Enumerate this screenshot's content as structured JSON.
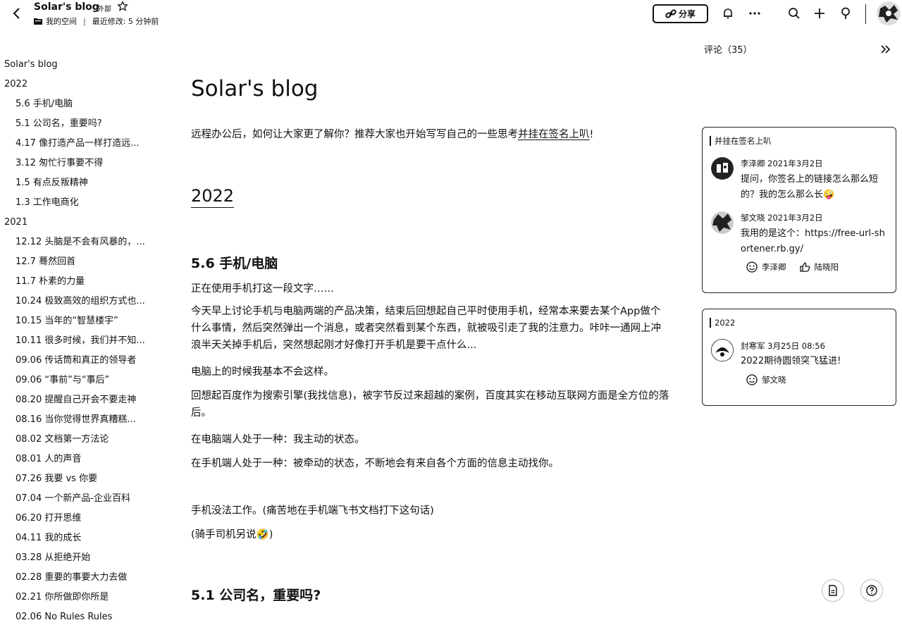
{
  "header": {
    "title": "Solar's blog",
    "external_badge": "外部",
    "location": "我的空间",
    "modified": "最近修改: 5 分钟前",
    "share_label": "分享"
  },
  "outline": {
    "items": [
      {
        "label": "Solar's blog",
        "level": 1
      },
      {
        "label": "2022",
        "level": 1
      },
      {
        "label": "5.6 手机/电脑",
        "level": 2
      },
      {
        "label": "5.1 公司名，重要吗?",
        "level": 2
      },
      {
        "label": "4.17 像打造产品一样打造远...",
        "level": 2
      },
      {
        "label": "3.12 匆忙行事要不得",
        "level": 2
      },
      {
        "label": "1.5 有点反叛精神",
        "level": 2
      },
      {
        "label": "1.3 工作电商化",
        "level": 2
      },
      {
        "label": "2021",
        "level": 1
      },
      {
        "label": "12.12 头脑是不会有风暴的，...",
        "level": 2
      },
      {
        "label": "12.7 蓦然回首",
        "level": 2
      },
      {
        "label": "11.7 朴素的力量",
        "level": 2
      },
      {
        "label": "10.24 极致高效的组织方式也...",
        "level": 2
      },
      {
        "label": "10.15 当年的“智慧楼宇”",
        "level": 2
      },
      {
        "label": "10.11 很多时候，我们并不知...",
        "level": 2
      },
      {
        "label": "09.06 传话筒和真正的领导者",
        "level": 2
      },
      {
        "label": "09.06 “事前”与“事后”",
        "level": 2
      },
      {
        "label": "08.20 提醒自己开会不要走神",
        "level": 2
      },
      {
        "label": "08.16 当你觉得世界真糟糕...",
        "level": 2
      },
      {
        "label": "08.02 文档第一方法论",
        "level": 2
      },
      {
        "label": "08.01 人的声音",
        "level": 2
      },
      {
        "label": "07.26 我要 vs 你要",
        "level": 2
      },
      {
        "label": "07.04 一个新产品-企业百科",
        "level": 2
      },
      {
        "label": "06.20 打开思维",
        "level": 2
      },
      {
        "label": "04.11 我的成长",
        "level": 2
      },
      {
        "label": "03.28 从拒绝开始",
        "level": 2
      },
      {
        "label": "02.28 重要的事要大力去做",
        "level": 2
      },
      {
        "label": "02.21 你所做即你所是",
        "level": 2
      },
      {
        "label": "02.06 No Rules Rules",
        "level": 2
      }
    ]
  },
  "doc": {
    "title": "Solar's blog",
    "intro_prefix": "远程办公后，如何让大家更了解你？推荐大家也开始写写自己的一些思考",
    "intro_link": "并挂在签名上叭",
    "intro_suffix": "!",
    "year_heading": "2022",
    "section1": {
      "heading": "5.6 手机/电脑",
      "p1": "正在使用手机打这一段文字……",
      "p2": "今天早上讨论手机与电脑两端的产品决策，结束后回想起自己平时使用手机，经常本来要去某个App做个什么事情，然后突然弹出一个消息，或者突然看到某个东西，就被吸引走了我的注意力。咔咔一通网上冲浪半天关掉手机后，突然想起刚才好像打开手机是要干点什么...",
      "p3": "电脑上的时候我基本不会这样。",
      "p4": "回想起百度作为搜索引擎(我找信息)，被字节反过来超越的案例，百度其实在移动互联网方面是全方位的落后。",
      "p5": "在电脑端人处于一种：我主动的状态。",
      "p6": "在手机端人处于一种：被牵动的状态，不断地会有来自各个方面的信息主动找你。",
      "p7": "手机没法工作。(痛苦地在手机端飞书文档打下这句话)",
      "p8": "(骑手司机另说🤣)"
    },
    "section2": {
      "heading": "5.1 公司名，重要吗?"
    }
  },
  "comments": {
    "title": "评论（35）",
    "card1": {
      "quote": "并挂在签名上叭",
      "c1_author": "李泽卿",
      "c1_date": "2021年3月2日",
      "c1_text": "提问，你签名上的链接怎么那么短的？我的怎么那么长🤪",
      "c2_author": "邹文晓",
      "c2_date": "2021年3月2日",
      "c2_text": "我用的是这个：https://free-url-shortener.rb.gy/",
      "react1": "李泽卿",
      "react2": "陆晓阳"
    },
    "card2": {
      "quote": "2022",
      "c1_author": "封寒军",
      "c1_date": "3月25日 08:56",
      "c1_text": "2022期待圆领突飞猛进!",
      "react1": "邹文晓"
    }
  }
}
